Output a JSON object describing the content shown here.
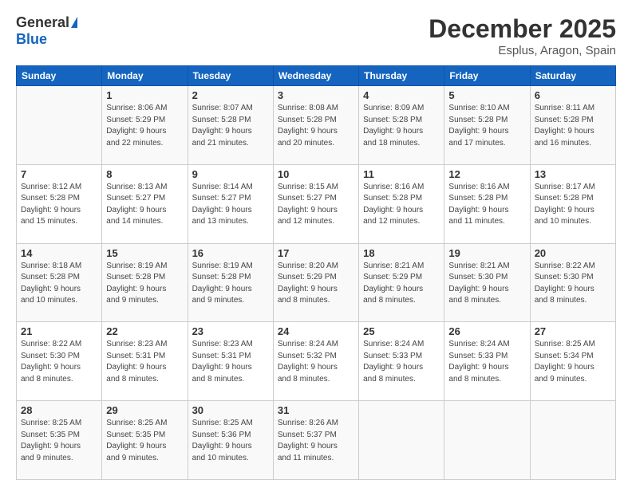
{
  "logo": {
    "general": "General",
    "blue": "Blue"
  },
  "header": {
    "title": "December 2025",
    "subtitle": "Esplus, Aragon, Spain"
  },
  "calendar": {
    "days_of_week": [
      "Sunday",
      "Monday",
      "Tuesday",
      "Wednesday",
      "Thursday",
      "Friday",
      "Saturday"
    ],
    "weeks": [
      [
        {
          "day": "",
          "info": ""
        },
        {
          "day": "1",
          "info": "Sunrise: 8:06 AM\nSunset: 5:29 PM\nDaylight: 9 hours\nand 22 minutes."
        },
        {
          "day": "2",
          "info": "Sunrise: 8:07 AM\nSunset: 5:28 PM\nDaylight: 9 hours\nand 21 minutes."
        },
        {
          "day": "3",
          "info": "Sunrise: 8:08 AM\nSunset: 5:28 PM\nDaylight: 9 hours\nand 20 minutes."
        },
        {
          "day": "4",
          "info": "Sunrise: 8:09 AM\nSunset: 5:28 PM\nDaylight: 9 hours\nand 18 minutes."
        },
        {
          "day": "5",
          "info": "Sunrise: 8:10 AM\nSunset: 5:28 PM\nDaylight: 9 hours\nand 17 minutes."
        },
        {
          "day": "6",
          "info": "Sunrise: 8:11 AM\nSunset: 5:28 PM\nDaylight: 9 hours\nand 16 minutes."
        }
      ],
      [
        {
          "day": "7",
          "info": "Sunrise: 8:12 AM\nSunset: 5:28 PM\nDaylight: 9 hours\nand 15 minutes."
        },
        {
          "day": "8",
          "info": "Sunrise: 8:13 AM\nSunset: 5:27 PM\nDaylight: 9 hours\nand 14 minutes."
        },
        {
          "day": "9",
          "info": "Sunrise: 8:14 AM\nSunset: 5:27 PM\nDaylight: 9 hours\nand 13 minutes."
        },
        {
          "day": "10",
          "info": "Sunrise: 8:15 AM\nSunset: 5:27 PM\nDaylight: 9 hours\nand 12 minutes."
        },
        {
          "day": "11",
          "info": "Sunrise: 8:16 AM\nSunset: 5:28 PM\nDaylight: 9 hours\nand 12 minutes."
        },
        {
          "day": "12",
          "info": "Sunrise: 8:16 AM\nSunset: 5:28 PM\nDaylight: 9 hours\nand 11 minutes."
        },
        {
          "day": "13",
          "info": "Sunrise: 8:17 AM\nSunset: 5:28 PM\nDaylight: 9 hours\nand 10 minutes."
        }
      ],
      [
        {
          "day": "14",
          "info": "Sunrise: 8:18 AM\nSunset: 5:28 PM\nDaylight: 9 hours\nand 10 minutes."
        },
        {
          "day": "15",
          "info": "Sunrise: 8:19 AM\nSunset: 5:28 PM\nDaylight: 9 hours\nand 9 minutes."
        },
        {
          "day": "16",
          "info": "Sunrise: 8:19 AM\nSunset: 5:28 PM\nDaylight: 9 hours\nand 9 minutes."
        },
        {
          "day": "17",
          "info": "Sunrise: 8:20 AM\nSunset: 5:29 PM\nDaylight: 9 hours\nand 8 minutes."
        },
        {
          "day": "18",
          "info": "Sunrise: 8:21 AM\nSunset: 5:29 PM\nDaylight: 9 hours\nand 8 minutes."
        },
        {
          "day": "19",
          "info": "Sunrise: 8:21 AM\nSunset: 5:30 PM\nDaylight: 9 hours\nand 8 minutes."
        },
        {
          "day": "20",
          "info": "Sunrise: 8:22 AM\nSunset: 5:30 PM\nDaylight: 9 hours\nand 8 minutes."
        }
      ],
      [
        {
          "day": "21",
          "info": "Sunrise: 8:22 AM\nSunset: 5:30 PM\nDaylight: 9 hours\nand 8 minutes."
        },
        {
          "day": "22",
          "info": "Sunrise: 8:23 AM\nSunset: 5:31 PM\nDaylight: 9 hours\nand 8 minutes."
        },
        {
          "day": "23",
          "info": "Sunrise: 8:23 AM\nSunset: 5:31 PM\nDaylight: 9 hours\nand 8 minutes."
        },
        {
          "day": "24",
          "info": "Sunrise: 8:24 AM\nSunset: 5:32 PM\nDaylight: 9 hours\nand 8 minutes."
        },
        {
          "day": "25",
          "info": "Sunrise: 8:24 AM\nSunset: 5:33 PM\nDaylight: 9 hours\nand 8 minutes."
        },
        {
          "day": "26",
          "info": "Sunrise: 8:24 AM\nSunset: 5:33 PM\nDaylight: 9 hours\nand 8 minutes."
        },
        {
          "day": "27",
          "info": "Sunrise: 8:25 AM\nSunset: 5:34 PM\nDaylight: 9 hours\nand 9 minutes."
        }
      ],
      [
        {
          "day": "28",
          "info": "Sunrise: 8:25 AM\nSunset: 5:35 PM\nDaylight: 9 hours\nand 9 minutes."
        },
        {
          "day": "29",
          "info": "Sunrise: 8:25 AM\nSunset: 5:35 PM\nDaylight: 9 hours\nand 9 minutes."
        },
        {
          "day": "30",
          "info": "Sunrise: 8:25 AM\nSunset: 5:36 PM\nDaylight: 9 hours\nand 10 minutes."
        },
        {
          "day": "31",
          "info": "Sunrise: 8:26 AM\nSunset: 5:37 PM\nDaylight: 9 hours\nand 11 minutes."
        },
        {
          "day": "",
          "info": ""
        },
        {
          "day": "",
          "info": ""
        },
        {
          "day": "",
          "info": ""
        }
      ]
    ]
  }
}
